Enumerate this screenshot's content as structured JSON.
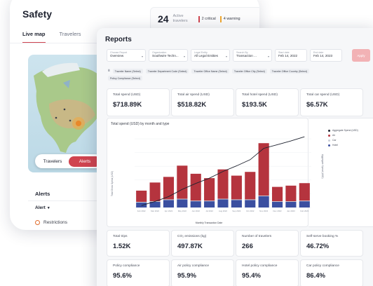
{
  "safety": {
    "title": "Safety",
    "tabs": [
      "Live map",
      "Travelers"
    ],
    "active": {
      "count": "24",
      "label": "Active travelers"
    },
    "badges": [
      {
        "text": "2 critical",
        "color": "#d0444f"
      },
      {
        "text": "4 warning",
        "color": "#f0a830"
      }
    ],
    "toggle": [
      "Travelers",
      "Alerts"
    ],
    "alerts_title": "Alerts",
    "alert_filter": "Alert",
    "restriction_item": "Restrictions"
  },
  "reports": {
    "title": "Reports",
    "filters": [
      {
        "label": "Choose Report",
        "value": "Overview"
      },
      {
        "label": "Organization",
        "value": "Southwire Techn..."
      },
      {
        "label": "Legal Entity",
        "value": "All Legal Entities"
      },
      {
        "label": "Search By",
        "value": "Transaction ..."
      },
      {
        "label": "Start date",
        "value": "Feb 14, 2022"
      },
      {
        "label": "End date",
        "value": "Feb 14, 2023"
      }
    ],
    "apply_label": "Apply",
    "chips": [
      "Traveler Name (Select)",
      "Traveler Department Code (Select)",
      "Traveler Office Name (Select)",
      "Traveler Office City (Select)",
      "Traveler Office Country (Select)",
      "Policy Compliance (Select)"
    ],
    "kpis_top": [
      {
        "label": "Total spend (USD)",
        "value": "$718.89K"
      },
      {
        "label": "Total air spend (USD)",
        "value": "$518.82K"
      },
      {
        "label": "Total hotel spend (USD)",
        "value": "$193.5K"
      },
      {
        "label": "Total car spend (USD)",
        "value": "$6.57K"
      }
    ],
    "kpis_mid": [
      {
        "label": "Total trips",
        "value": "1.52K"
      },
      {
        "label": "CO₂ emissions (kg)",
        "value": "497.87K"
      },
      {
        "label": "Number of travelers",
        "value": "266"
      },
      {
        "label": "Self-serve booking %",
        "value": "46.72%"
      }
    ],
    "kpis_bottom": [
      {
        "label": "Policy compliance",
        "value": "95.6%"
      },
      {
        "label": "Air policy compliance",
        "value": "95.9%"
      },
      {
        "label": "Hotel policy compliance",
        "value": "95.4%"
      },
      {
        "label": "Car policy compliance",
        "value": "86.4%"
      }
    ]
  },
  "chart_data": {
    "type": "bar",
    "title": "Total spend (USD) by month and type",
    "xlabel": "Monthly Transaction Date",
    "ylabel": "Total Gross Spend (USD)",
    "y2label": "Aggregate Spend (USD)",
    "categories": [
      "Feb 2022",
      "Mar 2022",
      "Apr 2022",
      "May 2022",
      "Jun 2022",
      "Jul 2022",
      "Aug 2022",
      "Sep 2022",
      "Oct 2022",
      "Nov 2022",
      "Dec 2022",
      "Jan 2023",
      "Feb 2023"
    ],
    "series": [
      {
        "name": "Air",
        "color": "#b5343e",
        "values": [
          18,
          30,
          36,
          53,
          43,
          36,
          47,
          38,
          44,
          84,
          23,
          25,
          28
        ]
      },
      {
        "name": "Car",
        "color": "#c9cdd6",
        "values": [
          1,
          1,
          1,
          1,
          1,
          1,
          1,
          1,
          1,
          1,
          1,
          1,
          1
        ]
      },
      {
        "name": "Hotel",
        "color": "#3b4fa0",
        "values": [
          8,
          9,
          12,
          13,
          10,
          10,
          13,
          12,
          12,
          18,
          9,
          9,
          10
        ]
      }
    ],
    "aggregate": {
      "name": "Aggregate Spend (USD)",
      "color": "#1f2330",
      "values": [
        18,
        55,
        99,
        164,
        218,
        266,
        327,
        378,
        434,
        537,
        570,
        604,
        642
      ]
    },
    "legend_position": "right",
    "grid": true
  }
}
